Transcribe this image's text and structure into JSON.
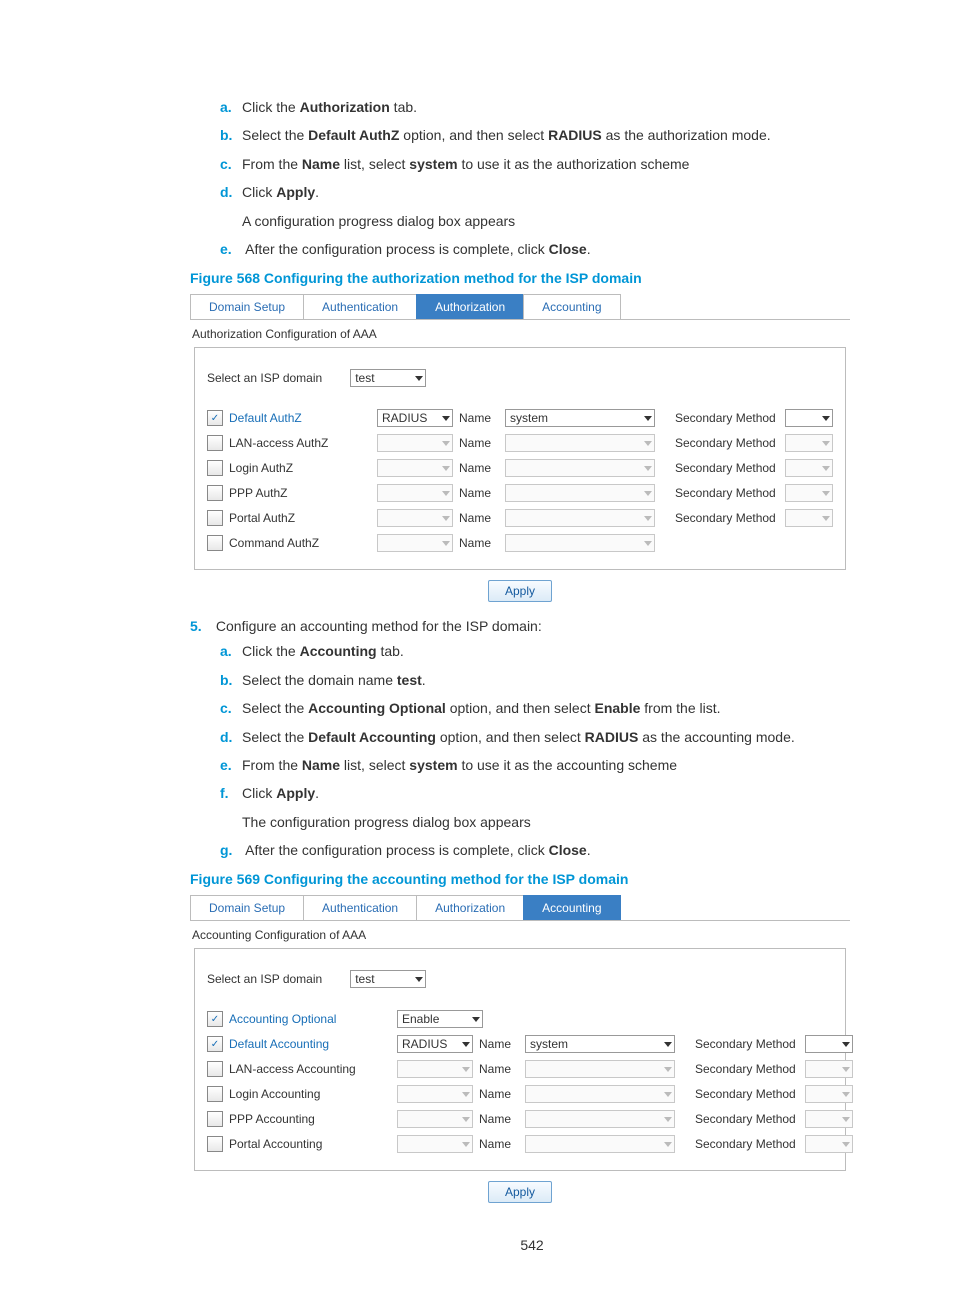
{
  "steps_authz": [
    {
      "m": "a.",
      "pre": "Click the ",
      "b1": "Authorization",
      "post": " tab."
    },
    {
      "m": "b.",
      "pre": "Select the ",
      "b1": "Default AuthZ",
      "mid": " option, and then select ",
      "b2": "RADIUS",
      "post": " as the authorization mode."
    },
    {
      "m": "c.",
      "pre": "From the ",
      "b1": "Name",
      "mid": " list, select ",
      "b2": "system",
      "post": " to use it as the authorization scheme"
    },
    {
      "m": "d.",
      "pre": "Click ",
      "b1": "Apply",
      "post": "."
    }
  ],
  "authz_note": "A configuration progress dialog box appears",
  "step_e_authz": {
    "m": "e.",
    "pre": "After the configuration process is complete, click ",
    "b1": "Close",
    "post": "."
  },
  "fig568": "Figure 568 Configuring the authorization method for the ISP domain",
  "panel1": {
    "tabs": [
      "Domain Setup",
      "Authentication",
      "Authorization",
      "Accounting"
    ],
    "activeTab": 2,
    "sectionTitle": "Authorization Configuration of AAA",
    "selectLabel": "Select an ISP domain",
    "selectVal": "test",
    "rows": [
      {
        "chk": true,
        "label": "Default AuthZ",
        "dd1": "RADIUS",
        "name": "Name",
        "dd2": "system",
        "sec": "Secondary Method",
        "en": true
      },
      {
        "chk": false,
        "label": "LAN-access AuthZ",
        "dd1": "",
        "name": "Name",
        "dd2": "",
        "sec": "Secondary Method",
        "en": false
      },
      {
        "chk": false,
        "label": "Login AuthZ",
        "dd1": "",
        "name": "Name",
        "dd2": "",
        "sec": "Secondary Method",
        "en": false
      },
      {
        "chk": false,
        "label": "PPP AuthZ",
        "dd1": "",
        "name": "Name",
        "dd2": "",
        "sec": "Secondary Method",
        "en": false
      },
      {
        "chk": false,
        "label": "Portal AuthZ",
        "dd1": "",
        "name": "Name",
        "dd2": "",
        "sec": "Secondary Method",
        "en": false
      },
      {
        "chk": false,
        "label": "Command AuthZ",
        "dd1": "",
        "name": "Name",
        "dd2": "",
        "sec": "",
        "en": false
      }
    ],
    "apply": "Apply"
  },
  "step5": {
    "num": "5.",
    "text": "Configure an accounting method for the ISP domain:"
  },
  "steps_acct": [
    {
      "m": "a.",
      "pre": "Click the ",
      "b1": "Accounting",
      "post": " tab."
    },
    {
      "m": "b.",
      "pre": "Select the domain name ",
      "b1": "test",
      "post": "."
    },
    {
      "m": "c.",
      "pre": "Select the ",
      "b1": "Accounting Optional",
      "mid": " option, and then select ",
      "b2": "Enable",
      "post": " from the list."
    },
    {
      "m": "d.",
      "pre": "Select the ",
      "b1": "Default Accounting",
      "mid": " option, and then select ",
      "b2": "RADIUS",
      "post": " as the accounting mode."
    },
    {
      "m": "e.",
      "pre": "From the ",
      "b1": "Name",
      "mid": " list, select ",
      "b2": "system",
      "post": " to use it as the accounting scheme"
    },
    {
      "m": "f.",
      "pre": "Click ",
      "b1": "Apply",
      "post": "."
    }
  ],
  "acct_note": "The configuration progress dialog box appears",
  "step_g_acct": {
    "m": "g.",
    "pre": "After the configuration process is complete, click ",
    "b1": "Close",
    "post": "."
  },
  "fig569": "Figure 569 Configuring the accounting method for the ISP domain",
  "panel2": {
    "tabs": [
      "Domain Setup",
      "Authentication",
      "Authorization",
      "Accounting"
    ],
    "activeTab": 3,
    "sectionTitle": "Accounting Configuration of AAA",
    "selectLabel": "Select an ISP domain",
    "selectVal": "test",
    "optRow": {
      "chk": true,
      "label": "Accounting Optional",
      "dd1": "Enable"
    },
    "rows": [
      {
        "chk": true,
        "label": "Default Accounting",
        "dd1": "RADIUS",
        "name": "Name",
        "dd2": "system",
        "sec": "Secondary Method",
        "en": true
      },
      {
        "chk": false,
        "label": "LAN-access Accounting",
        "dd1": "",
        "name": "Name",
        "dd2": "",
        "sec": "Secondary Method",
        "en": false
      },
      {
        "chk": false,
        "label": "Login Accounting",
        "dd1": "",
        "name": "Name",
        "dd2": "",
        "sec": "Secondary Method",
        "en": false
      },
      {
        "chk": false,
        "label": "PPP Accounting",
        "dd1": "",
        "name": "Name",
        "dd2": "",
        "sec": "Secondary Method",
        "en": false
      },
      {
        "chk": false,
        "label": "Portal Accounting",
        "dd1": "",
        "name": "Name",
        "dd2": "",
        "sec": "Secondary Method",
        "en": false
      }
    ],
    "apply": "Apply"
  },
  "pageNum": "542"
}
